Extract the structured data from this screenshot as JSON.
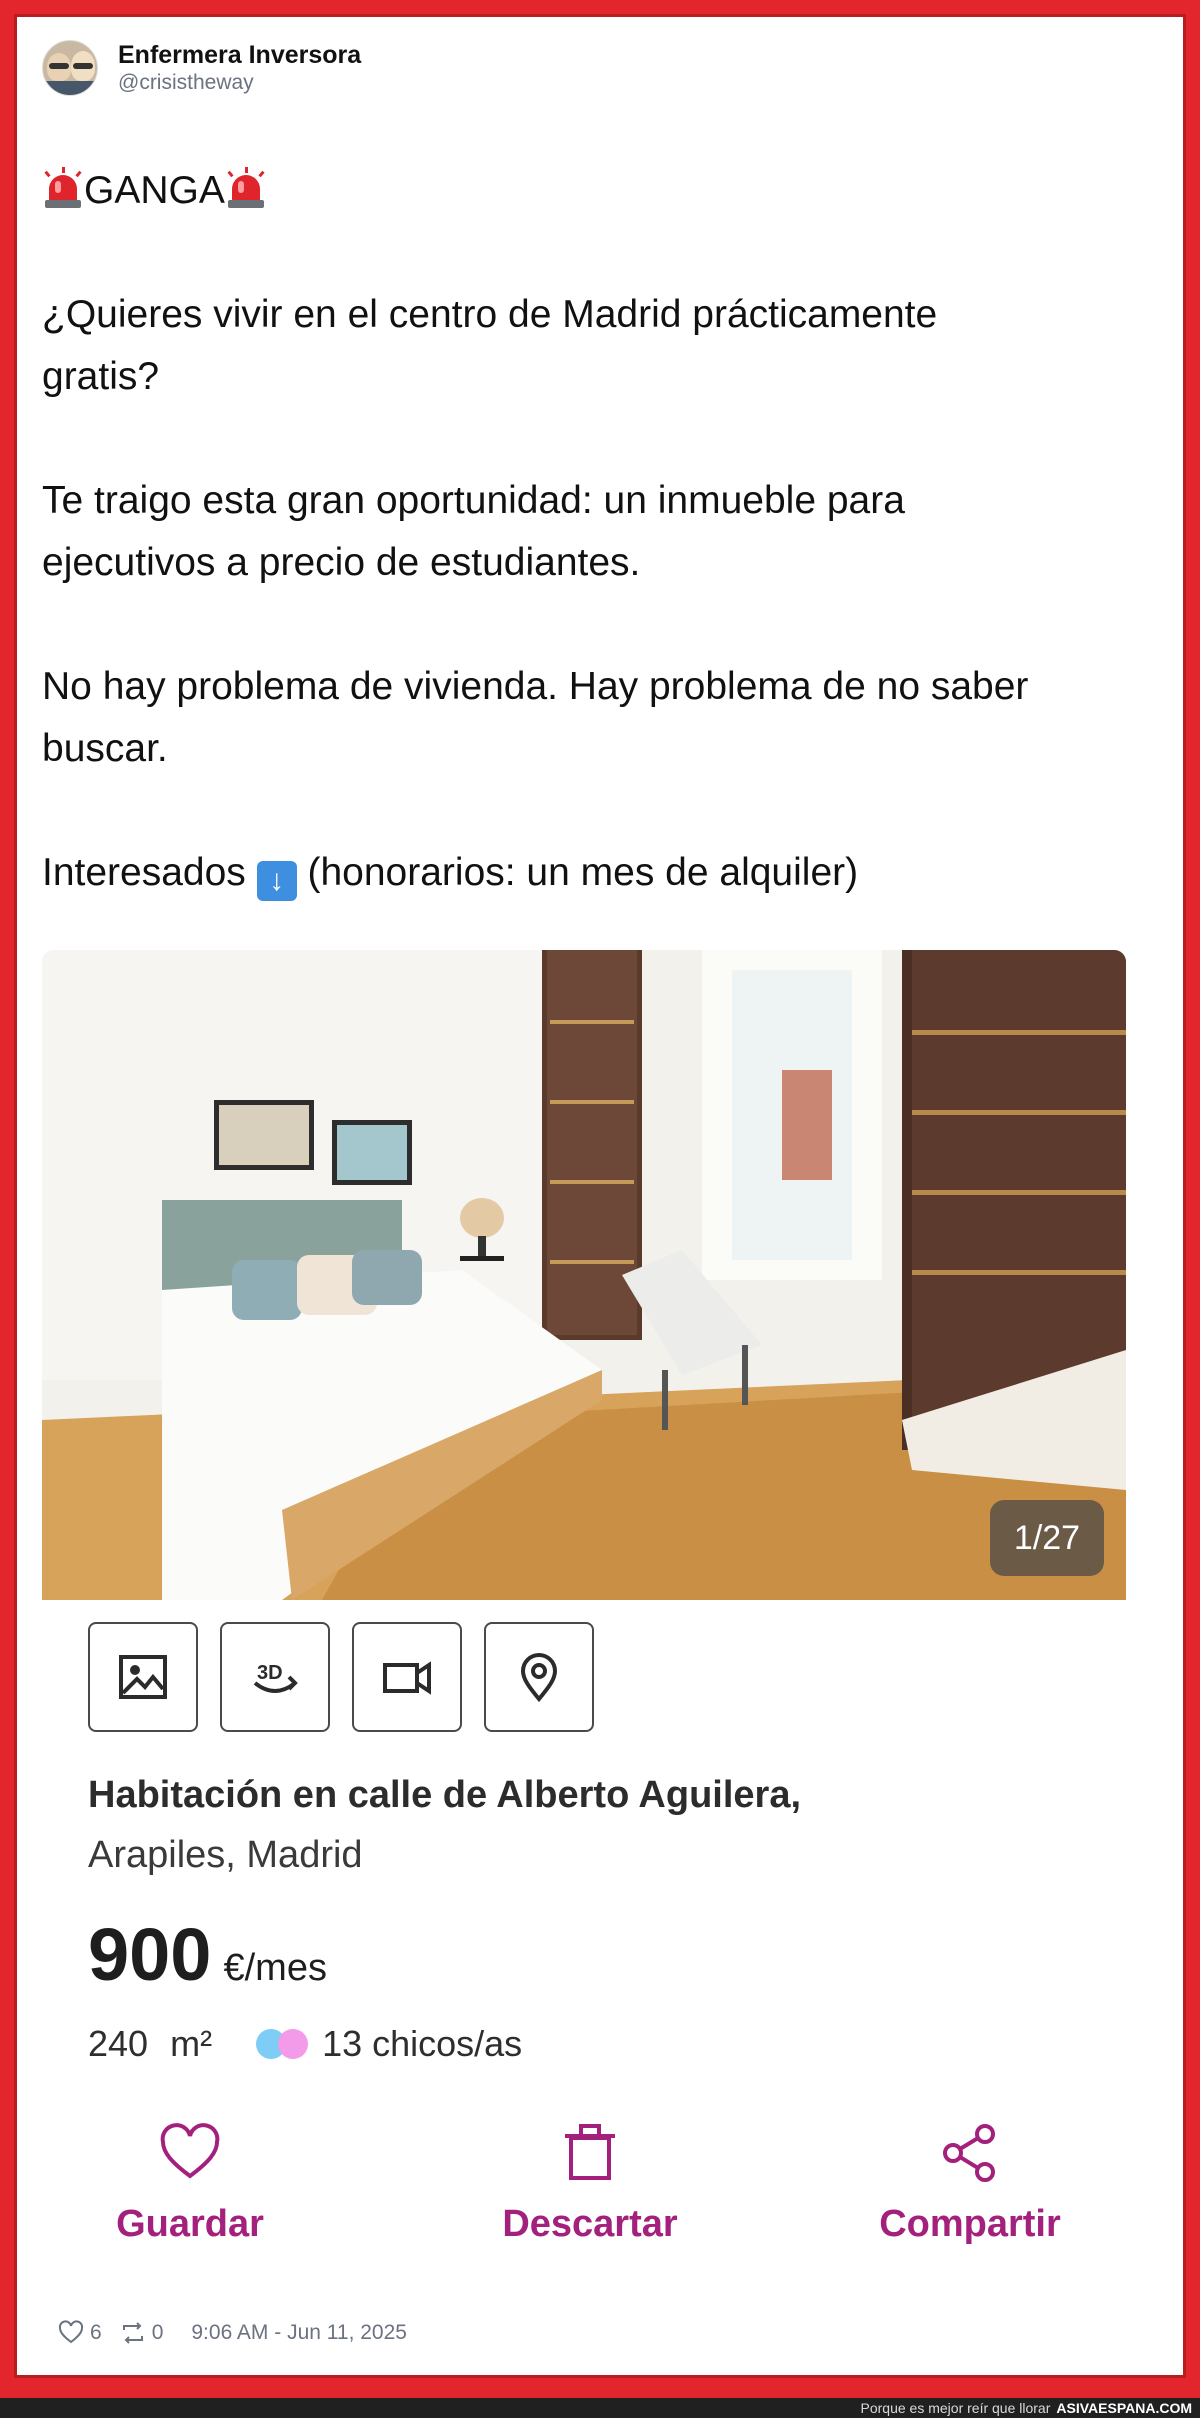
{
  "author": {
    "name": "Enfermera Inversora",
    "handle": "@crisistheway",
    "avatar_icon": "profile-photo"
  },
  "tweet": {
    "headline": "GANGA",
    "headline_icon": "police-car-light-emoji",
    "line1": "¿Quieres vivir en el centro de Madrid prácticamente gratis?",
    "line2": "Te traigo esta gran oportunidad: un inmueble para ejecutivos a precio de estudiantes.",
    "line3": "No hay problema de vivienda. Hay problema de no saber buscar.",
    "line4_before": "Interesados",
    "line4_icon": "down-arrow-emoji",
    "line4_after": "(honorarios: un mes de alquiler)"
  },
  "photo": {
    "counter": "1/27"
  },
  "listing": {
    "media_buttons": [
      {
        "icon": "image-icon"
      },
      {
        "icon": "3d-tour-icon"
      },
      {
        "icon": "video-camera-icon"
      },
      {
        "icon": "location-pin-icon"
      }
    ],
    "title": "Habitación en calle de Alberto Aguilera,",
    "location": "Arapiles, Madrid",
    "price": "900",
    "price_unit": "€/mes",
    "area": "240",
    "area_unit": "m²",
    "occupants": "13 chicos/as",
    "accent_color": "#a3217d"
  },
  "actions": {
    "save": "Guardar",
    "discard": "Descartar",
    "share": "Compartir"
  },
  "footer": {
    "likes": "6",
    "retweets": "0",
    "timestamp": "9:06 AM - Jun 11, 2025"
  },
  "watermark": {
    "tagline": "Porque es mejor reír que llorar",
    "site": "ASIVAESPANA.COM"
  }
}
